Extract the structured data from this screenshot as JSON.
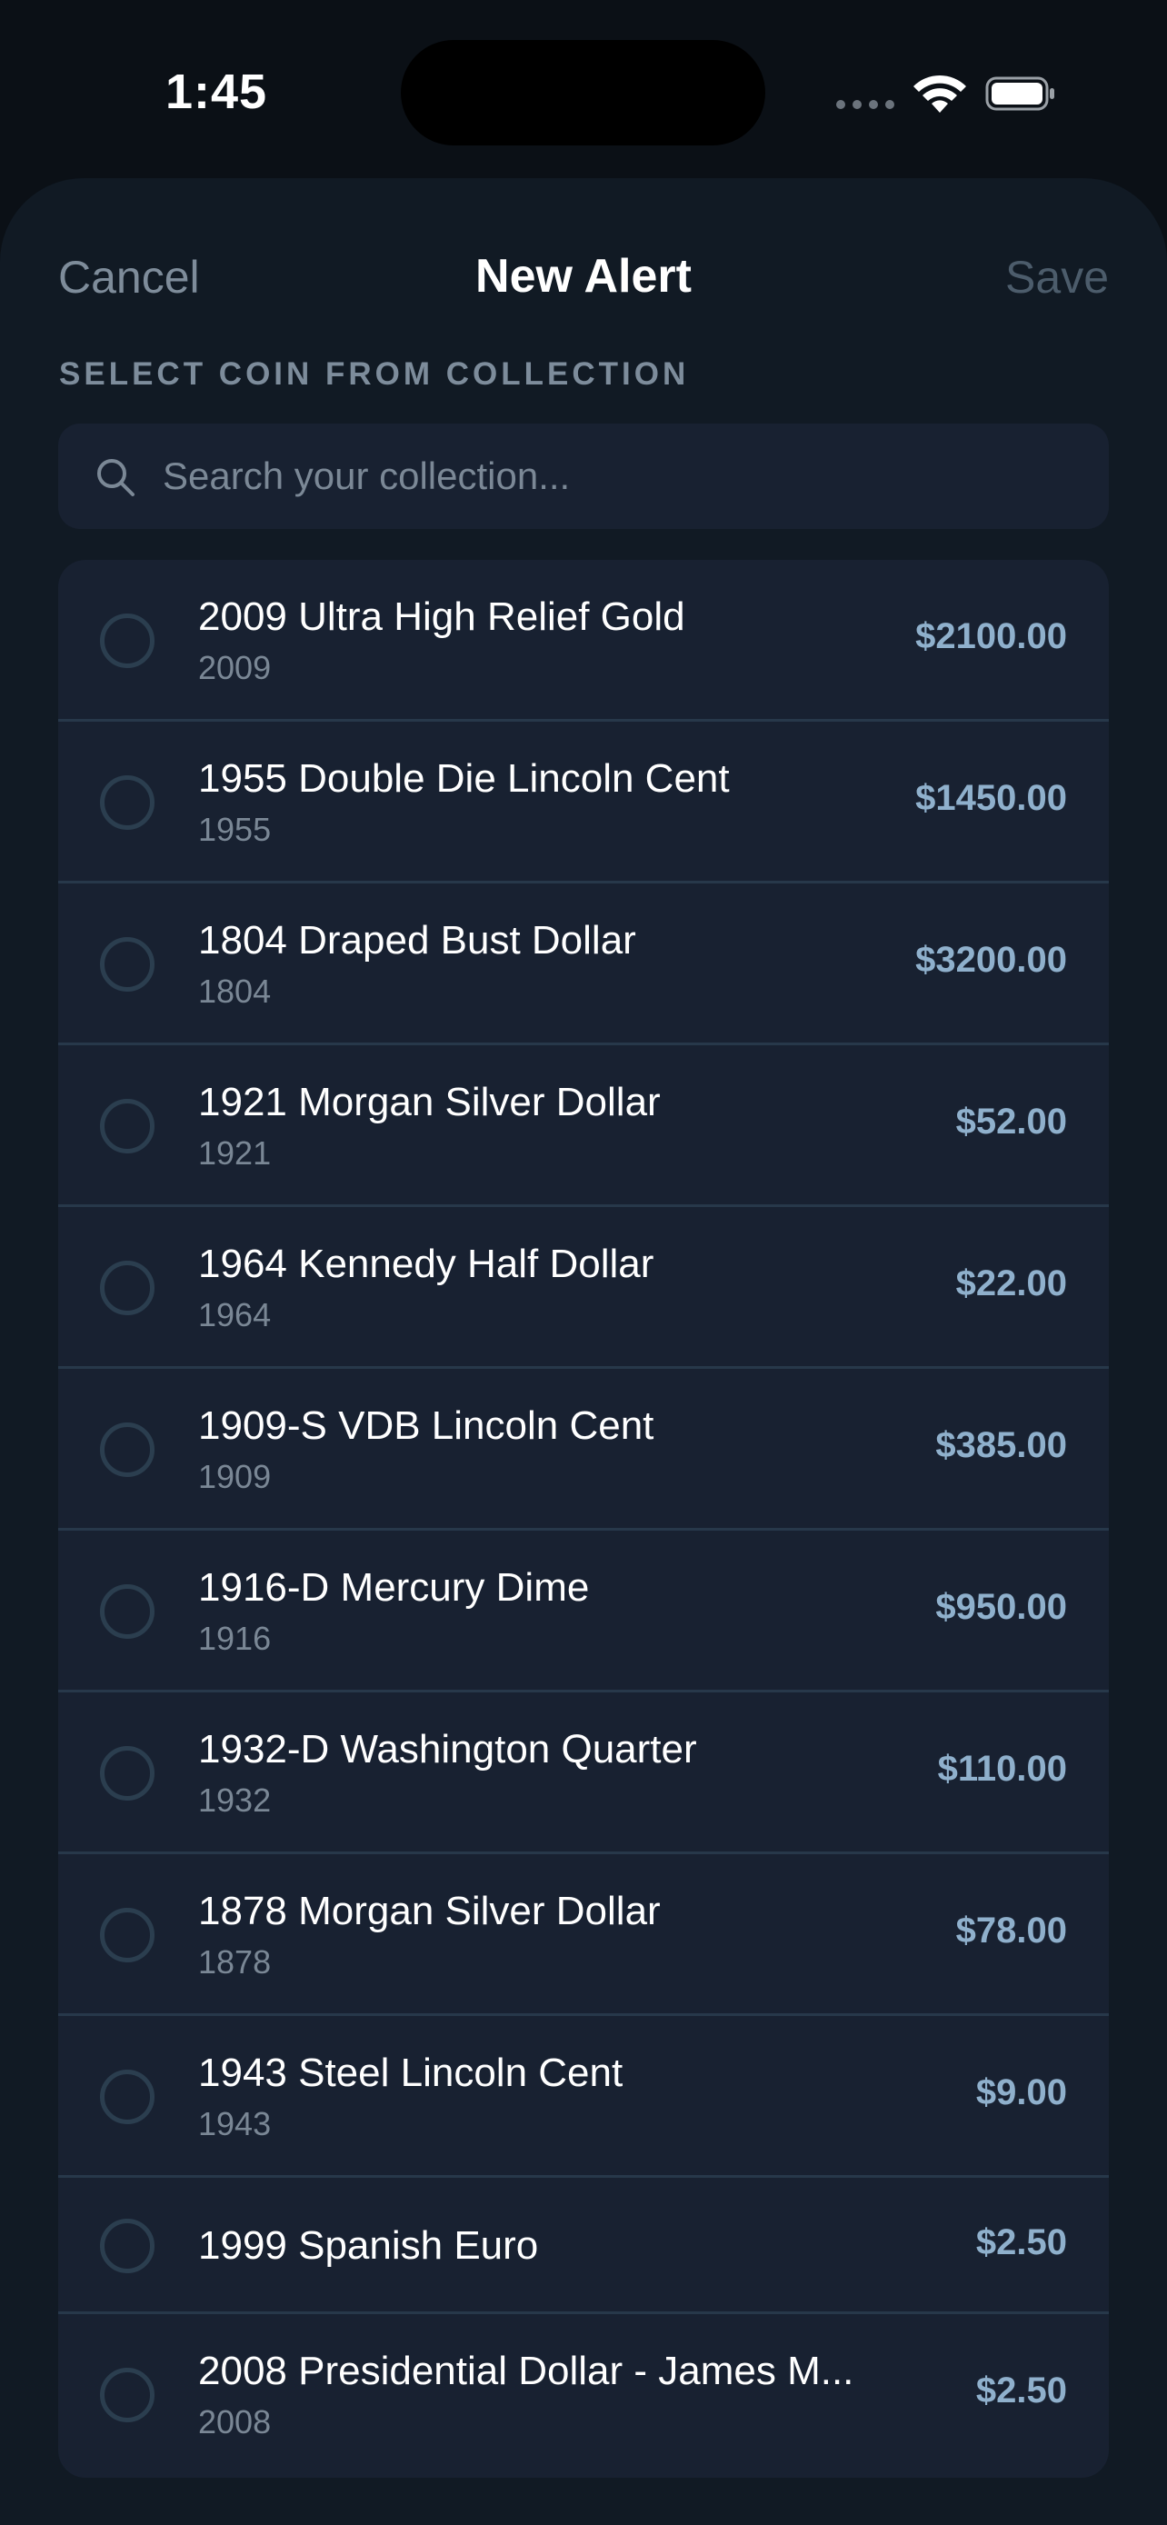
{
  "status_bar": {
    "time": "1:45"
  },
  "nav": {
    "cancel": "Cancel",
    "title": "New Alert",
    "save": "Save"
  },
  "section_label": "SELECT COIN FROM COLLECTION",
  "search": {
    "placeholder": "Search your collection..."
  },
  "coins": [
    {
      "name": "2009 Ultra High Relief Gold",
      "year": "2009",
      "value": "$2100.00"
    },
    {
      "name": "1955 Double Die Lincoln Cent",
      "year": "1955",
      "value": "$1450.00"
    },
    {
      "name": "1804 Draped Bust Dollar",
      "year": "1804",
      "value": "$3200.00"
    },
    {
      "name": "1921 Morgan Silver Dollar",
      "year": "1921",
      "value": "$52.00"
    },
    {
      "name": "1964 Kennedy Half Dollar",
      "year": "1964",
      "value": "$22.00"
    },
    {
      "name": "1909-S VDB Lincoln Cent",
      "year": "1909",
      "value": "$385.00"
    },
    {
      "name": "1916-D Mercury Dime",
      "year": "1916",
      "value": "$950.00"
    },
    {
      "name": "1932-D Washington Quarter",
      "year": "1932",
      "value": "$110.00"
    },
    {
      "name": "1878 Morgan Silver Dollar",
      "year": "1878",
      "value": "$78.00"
    },
    {
      "name": "1943 Steel Lincoln Cent",
      "year": "1943",
      "value": "$9.00"
    },
    {
      "name": "1999 Spanish Euro",
      "year": "",
      "value": "$2.50"
    },
    {
      "name": "2008 Presidential Dollar - James M...",
      "year": "2008",
      "value": "$2.50"
    }
  ]
}
